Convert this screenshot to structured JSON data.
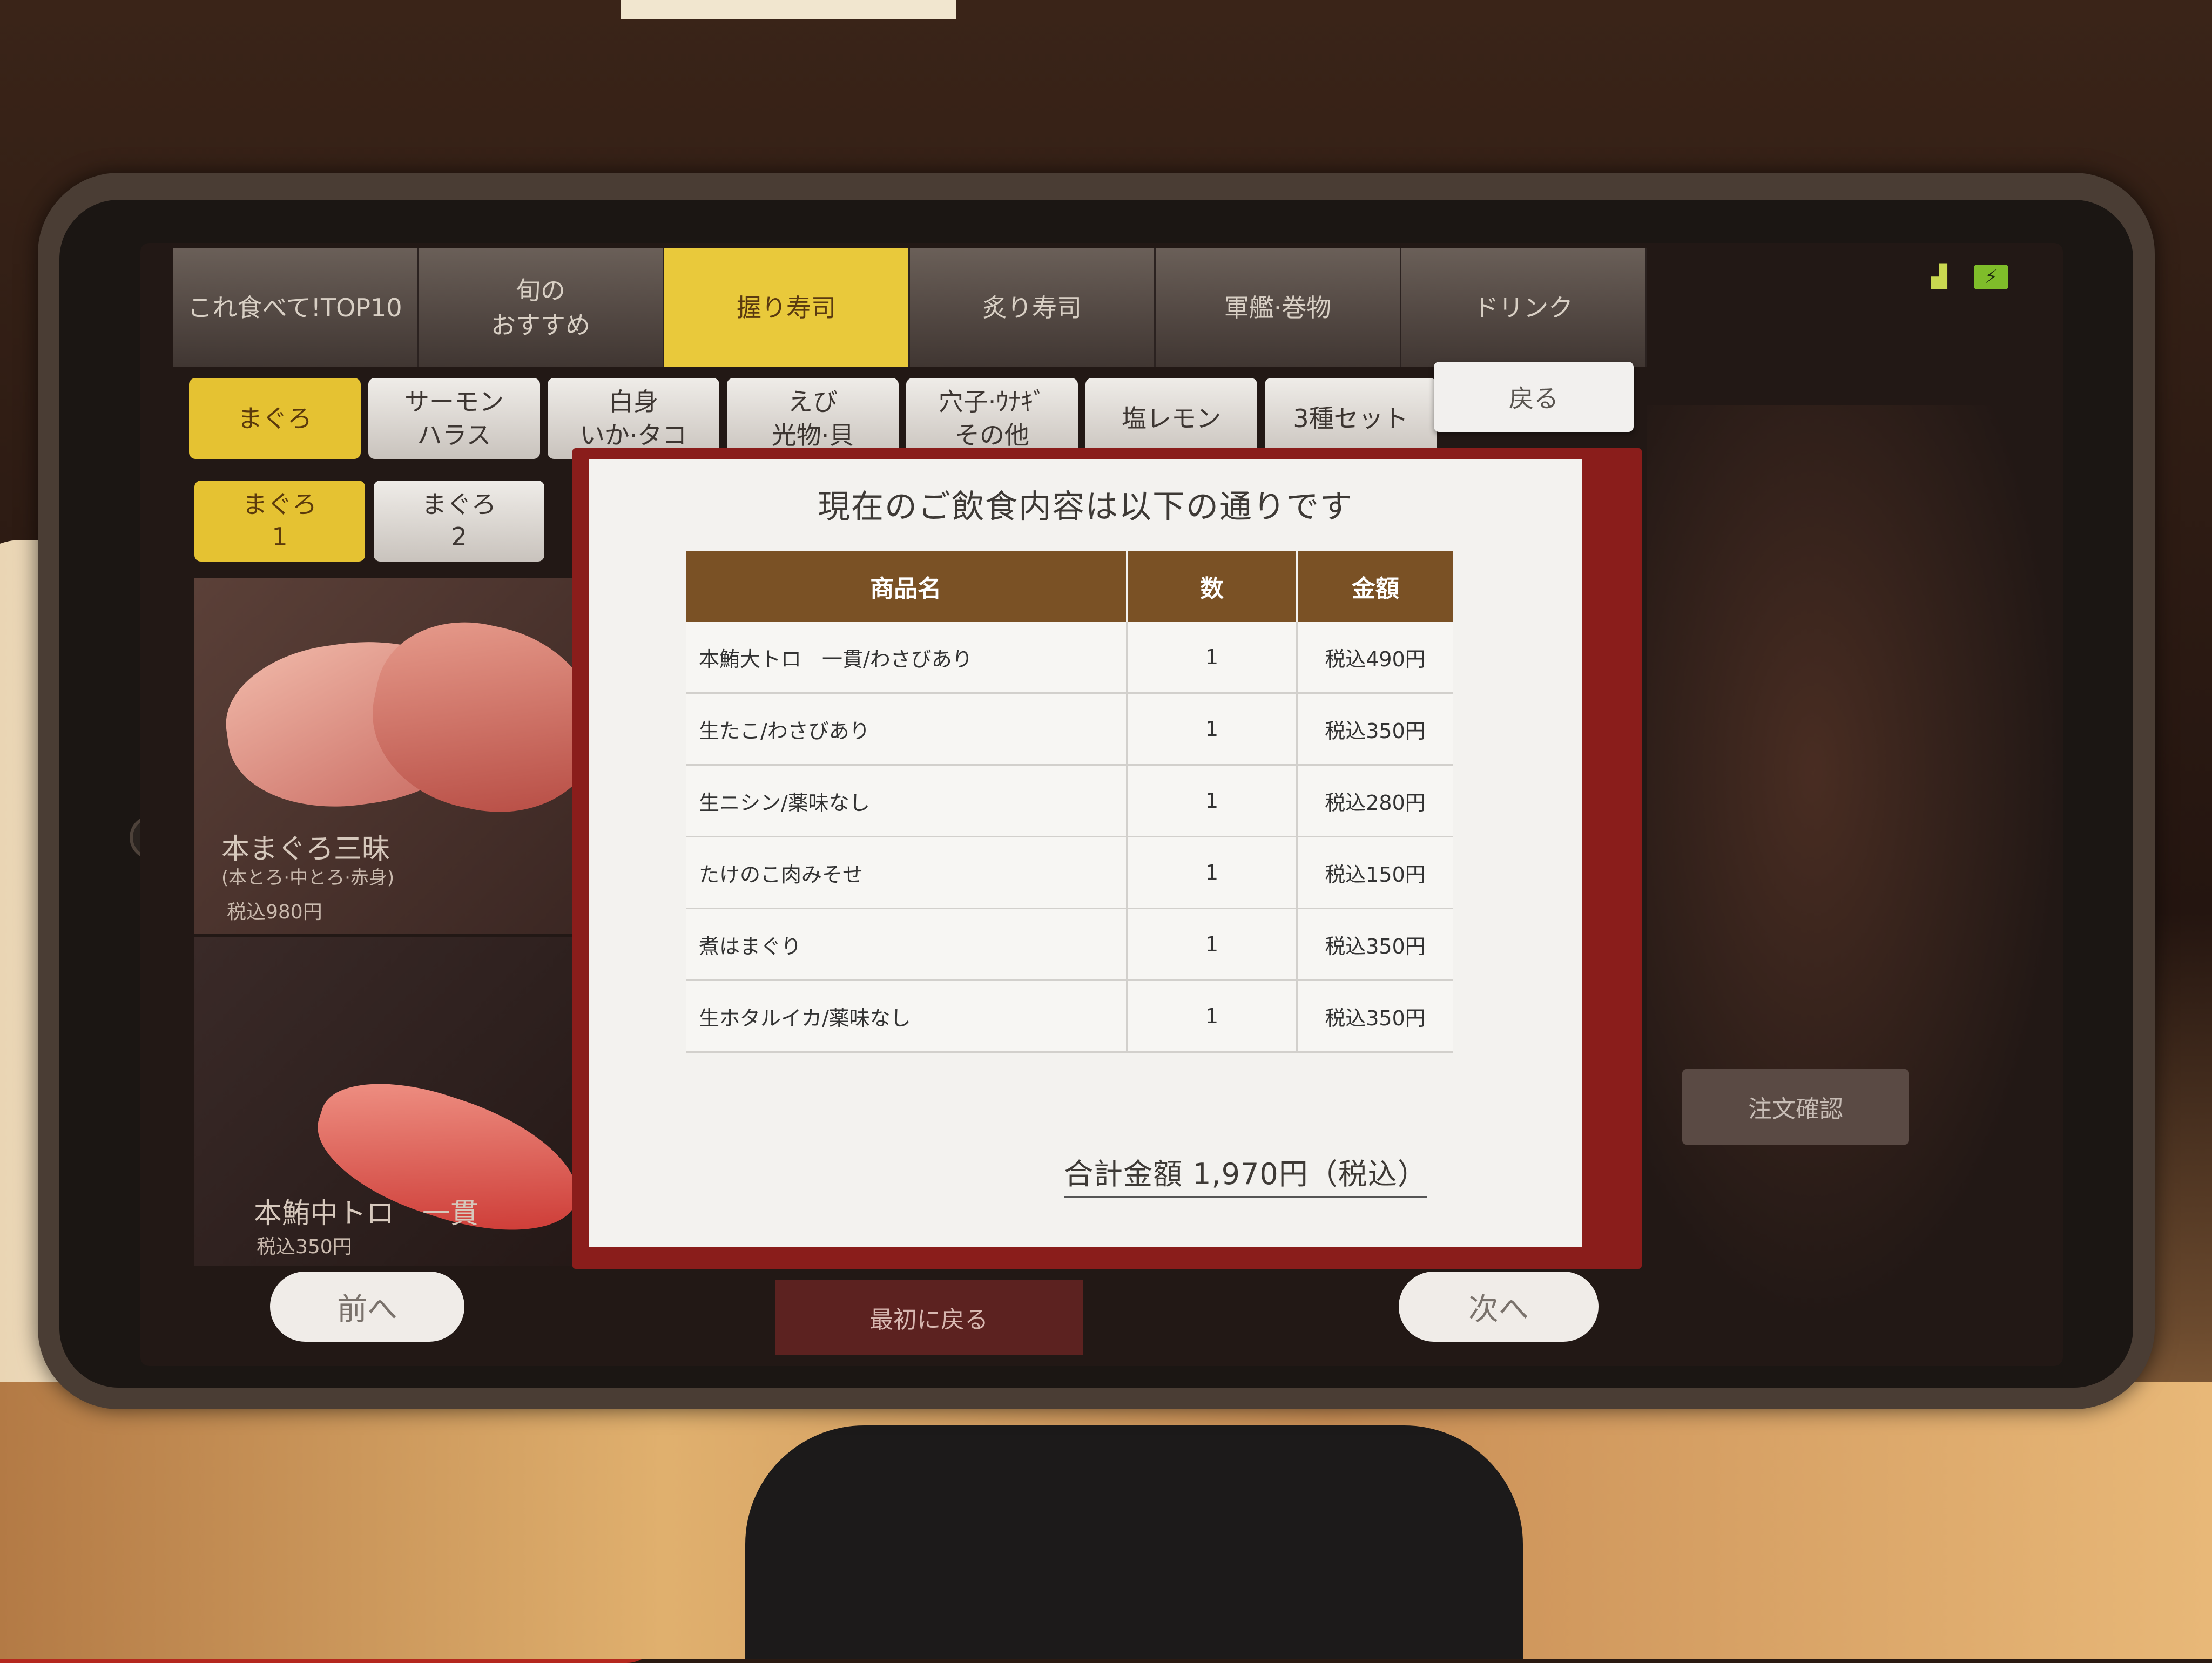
{
  "categories": [
    {
      "label": "これ食べて!TOP10",
      "active": false
    },
    {
      "label": "旬の\nおすすめ",
      "active": false
    },
    {
      "label": "握り寿司",
      "active": true
    },
    {
      "label": "炙り寿司",
      "active": false
    },
    {
      "label": "軍艦·巻物",
      "active": false
    },
    {
      "label": "ドリンク",
      "active": false
    }
  ],
  "subcategories": [
    {
      "label": "まぐろ",
      "active": true
    },
    {
      "label": "サーモン\nハラス",
      "active": false
    },
    {
      "label": "白身\nいか·タコ",
      "active": false
    },
    {
      "label": "えび\n光物·貝",
      "active": false
    },
    {
      "label": "穴子·ｳﾅｷﾞ\nその他",
      "active": false
    },
    {
      "label": "塩レモン",
      "active": false
    },
    {
      "label": "3種セット",
      "active": false
    }
  ],
  "sub2": [
    {
      "label": "まぐろ\n1",
      "active": true
    },
    {
      "label": "まぐろ\n2",
      "active": false
    }
  ],
  "back_label": "戻る",
  "tiles": [
    {
      "name": "本まぐろ三昧",
      "sub": "(本とろ·中とろ·赤身)",
      "price": "税込980円"
    },
    {
      "name": "本鮪中トロ　一貫",
      "price": "税込350円"
    }
  ],
  "nav": {
    "prev": "前へ",
    "first": "最初に戻る",
    "next": "次へ",
    "confirm": "注文確認"
  },
  "modal": {
    "title": "現在のご飲食内容は以下の通りです",
    "headers": {
      "name": "商品名",
      "qty": "数",
      "price": "金額"
    },
    "rows": [
      {
        "name": "本鮪大トロ　一貫/わさびあり",
        "qty": "1",
        "price": "税込490円"
      },
      {
        "name": "生たこ/わさびあり",
        "qty": "1",
        "price": "税込350円"
      },
      {
        "name": "生ニシン/薬味なし",
        "qty": "1",
        "price": "税込280円"
      },
      {
        "name": "たけのこ肉みそせ",
        "qty": "1",
        "price": "税込150円"
      },
      {
        "name": "煮はまぐり",
        "qty": "1",
        "price": "税込350円"
      },
      {
        "name": "生ホタルイカ/薬味なし",
        "qty": "1",
        "price": "税込350円"
      }
    ],
    "total": "合計金額 1,970円（税込）"
  },
  "colors": {
    "accent_yellow": "#e9c93b",
    "header_brown": "#7a5125",
    "frame_red": "#8a1d1b"
  }
}
